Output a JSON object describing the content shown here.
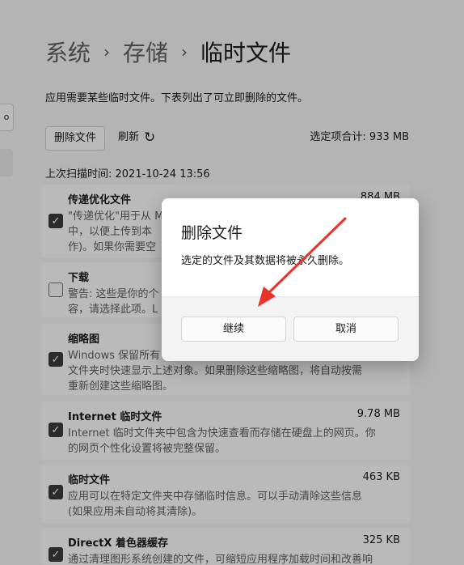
{
  "breadcrumb": {
    "items": [
      "系统",
      "存储",
      "临时文件"
    ],
    "separator": "›"
  },
  "description": "应用需要某些临时文件。下表列出了可立即删除的文件。",
  "toolbar": {
    "delete_label": "删除文件",
    "refresh_label": "刷新",
    "refresh_icon": "↻",
    "total": "选定项合计: 933 MB"
  },
  "scan_time": "上次扫描时间: 2021-10-24 13:56",
  "left_edge_glyph": "o",
  "items": [
    {
      "title": "传递优化文件",
      "size": "884 MB",
      "checked": true,
      "lines": [
        "\"传递优化\"用于从 M",
        "中，以便上传到本",
        "作)。如果你需要空"
      ]
    },
    {
      "title": "下载",
      "size": "",
      "checked": false,
      "lines": [
        "警告: 这些是你的个",
        "容，请选择此项。L"
      ]
    },
    {
      "title": "缩略图",
      "size": "",
      "checked": true,
      "lines": [
        "Windows 保留所有",
        "文件夹时快速显示上述对象。如果删除这些缩略图，将自动按需",
        "重新创建这些缩略图。"
      ]
    },
    {
      "title": "Internet 临时文件",
      "size": "9.78 MB",
      "checked": true,
      "lines": [
        "Internet 临时文件夹中包含为快速查看而存储在硬盘上的网页。你",
        "的网页个性化设置将被完整保留。"
      ]
    },
    {
      "title": "临时文件",
      "size": "463 KB",
      "checked": true,
      "lines": [
        "应用可以在特定文件夹中存储临时信息。可以手动清除这些信息",
        "(如果应用未自动将其清除)。"
      ]
    },
    {
      "title": "DirectX 着色器缓存",
      "size": "325 KB",
      "checked": true,
      "lines": [
        "通过清理图形系统创建的文件，可缩短应用程序加载时间和改善响"
      ]
    }
  ],
  "checkmark": "✓",
  "dialog": {
    "title": "删除文件",
    "message": "选定的文件及其数据将被永久删除。",
    "continue_label": "继续",
    "cancel_label": "取消"
  },
  "colors": {
    "annotation_arrow": "#e8322a",
    "checkbox_fill": "#3b3b3b"
  }
}
